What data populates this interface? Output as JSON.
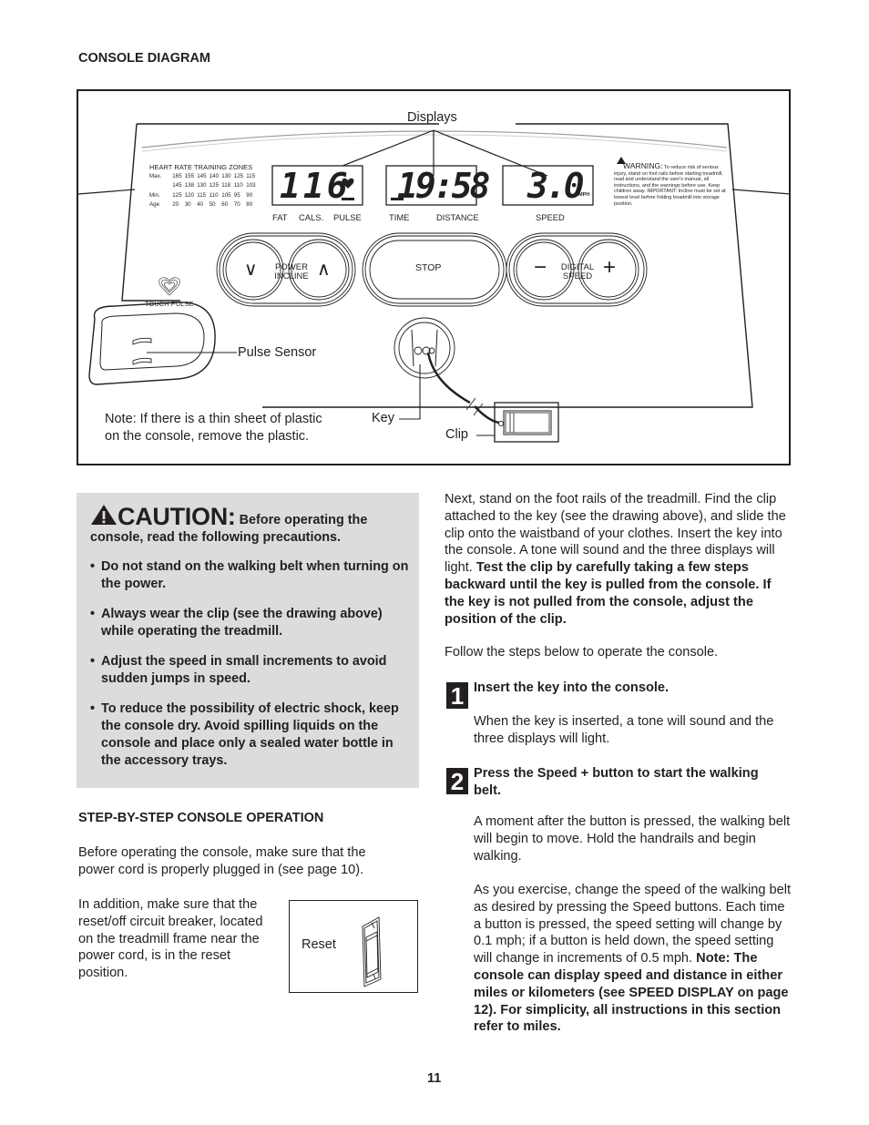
{
  "page": {
    "section_title": "CONSOLE DIAGRAM",
    "page_number": "11"
  },
  "diagram": {
    "callouts": {
      "displays": "Displays",
      "pulse_sensor": "Pulse Sensor",
      "key": "Key",
      "clip": "Clip"
    },
    "note": [
      "Note: If there is a thin sheet of plastic",
      "on the console, remove the plastic."
    ],
    "heart_rate_zones": {
      "title": "HEART RATE TRAINING ZONES",
      "rows": [
        {
          "label": "Max.",
          "values": [
            "165",
            "155",
            "145",
            "140",
            "130",
            "125",
            "115"
          ]
        },
        {
          "label": "",
          "values": [
            "145",
            "138",
            "130",
            "125",
            "118",
            "110",
            "103"
          ]
        },
        {
          "label": "Min.",
          "values": [
            "125",
            "120",
            "115",
            "110",
            "105",
            "95",
            "90"
          ]
        },
        {
          "label": "Age",
          "values": [
            "20",
            "30",
            "40",
            "50",
            "60",
            "70",
            "80"
          ]
        }
      ]
    },
    "displays": [
      {
        "value": "116",
        "labels": [
          "FAT",
          "CALS.",
          "PULSE"
        ],
        "indicator": "heart"
      },
      {
        "value": "19:58",
        "labels": [
          "TIME",
          "DISTANCE"
        ]
      },
      {
        "value": "3.0",
        "unit": "MPH",
        "labels": [
          "SPEED"
        ]
      }
    ],
    "warning": {
      "heading": "WARNING:",
      "text": "To reduce risk of serious injury, stand on foot rails before starting treadmill, read and understand the user's manual, all instructions, and the warnings before use. Keep children away. IMPORTANT: Incline must be set at lowest level before folding treadmill into storage position."
    },
    "buttons": {
      "incline_down": "∨",
      "incline_label": [
        "POWER",
        "INCLINE"
      ],
      "incline_up": "∧",
      "stop": "STOP",
      "speed_down": "−",
      "speed_label": [
        "DIGITAL",
        "SPEED"
      ],
      "speed_up": "+"
    },
    "touch_pulse_label": "TOUCH PULSE"
  },
  "caution": {
    "word": "CAUTION:",
    "intro": "Before operating the console, read the following precautions.",
    "items": [
      "Do not stand on the walking belt when turning on the power.",
      "Always wear the clip (see the drawing above) while operating the treadmill.",
      "Adjust the speed in small increments to avoid sudden jumps in speed.",
      "To reduce the possibility of electric shock, keep the console dry. Avoid spilling liquids on the console and place only a sealed water bottle in the accessory trays."
    ]
  },
  "operation": {
    "title": "STEP-BY-STEP CONSOLE OPERATION",
    "para1": "Before operating the console, make sure that the power cord is properly plugged in (see page 10).",
    "para2": "In addition, make sure that the reset/off circuit breaker, located on the treadmill frame near the power cord, is in the reset position.",
    "reset_label": "Reset"
  },
  "right_column": {
    "intro_plain": "Next, stand on the foot rails of the treadmill. Find the clip attached to the key (see the drawing above), and slide the clip onto the waistband of your clothes. Insert the key into the console. A tone will sound and the three displays will light. ",
    "intro_bold": "Test the clip by carefully taking a few steps backward until the key is pulled from the console. If the key is not pulled from the console, adjust the position of the clip.",
    "follow": "Follow the steps below to operate the console.",
    "steps": [
      {
        "number": "1",
        "heading": "Insert the key into the console.",
        "paragraphs": [
          {
            "plain": "When the key is inserted, a tone will sound and the three displays will light.",
            "bold": ""
          }
        ]
      },
      {
        "number": "2",
        "heading": "Press the Speed + button to start the walking belt.",
        "paragraphs": [
          {
            "plain": "A moment after the button is pressed, the walking belt will begin to move. Hold the handrails and begin walking.",
            "bold": ""
          },
          {
            "plain": "As you exercise, change the speed of the walking belt as desired by pressing the Speed buttons. Each time a button is pressed, the speed setting will change by 0.1 mph; if a button is held down, the speed setting will change in increments of 0.5 mph. ",
            "bold": "Note: The console can display speed and distance in either miles or kilometers (see SPEED DISPLAY on page 12). For simplicity, all instructions in this section refer to miles."
          }
        ]
      }
    ]
  }
}
